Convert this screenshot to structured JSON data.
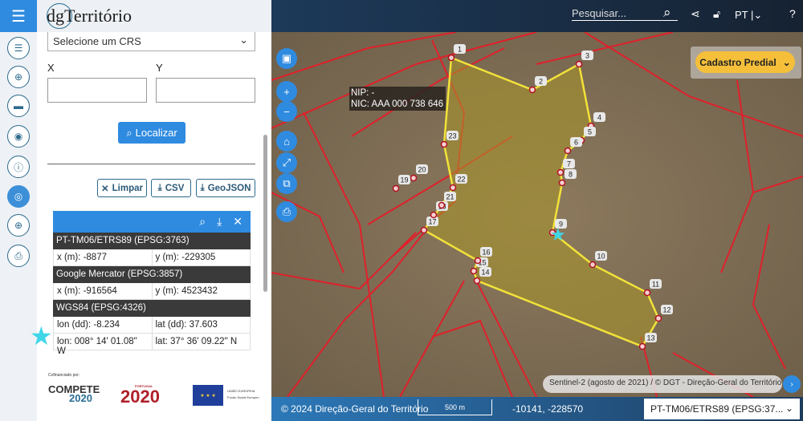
{
  "header": {
    "logo": "dgTerritório",
    "search_placeholder": "Pesquisar...",
    "language": "PT"
  },
  "rail": {
    "icons": [
      "menu-icon",
      "list-icon",
      "add-circle-icon",
      "ruler-icon",
      "palette-icon",
      "info-icon",
      "target-icon",
      "globe-icon",
      "print-icon"
    ],
    "active": "target-icon"
  },
  "panel": {
    "crs_select": "Selecione um CRS",
    "x_label": "X",
    "y_label": "Y",
    "x_value": "",
    "y_value": "",
    "localizar": "Localizar",
    "limpar": "Limpar",
    "csv": "CSV",
    "geojson": "GeoJSON",
    "results": [
      {
        "crs": "PT-TM06/ETRS89 (EPSG:3763)",
        "a": "x (m): -8877",
        "b": "y (m): -229305"
      },
      {
        "crs": "Google Mercator (EPSG:3857)",
        "a": "x (m): -916564",
        "b": "y (m): 4523432"
      },
      {
        "crs": "WGS84 (EPSG:4326)",
        "a": "lon (dd): -8.234",
        "b": "lat (dd): 37.603",
        "c": "lon: 008° 14' 01.08\" W",
        "d": "lat: 37° 36' 09.22\" N"
      }
    ],
    "cofinanciado": "Cofinanciado por:",
    "logos": {
      "compete": "COMPETE",
      "compete_year": "2020",
      "portugal": "PORTUGAL",
      "portugal_year": "2020",
      "eu1": "UNIÃO EUROPEIA",
      "eu2": "Fundo Social Europeu"
    }
  },
  "map": {
    "tooltip": {
      "nip": "NIP: -",
      "nic": "NIC: AAA 000 738 646"
    },
    "layer_button": "Cadastro Predial",
    "vertex_labels": [
      "1",
      "2",
      "3",
      "4",
      "5",
      "6",
      "7",
      "8",
      "9",
      "10",
      "11",
      "12",
      "13",
      "14",
      "15",
      "16",
      "17",
      "18",
      "19",
      "20",
      "21",
      "22",
      "23"
    ],
    "attribution": "Sentinel-2 (agosto de 2021) / © DGT - Direção-Geral do Território",
    "colors": {
      "parcel_lines": "#e0202a",
      "selected_outline": "#f2e23a",
      "selected_fill": "#b89a2a",
      "marker": "#3fd6e8"
    }
  },
  "footer": {
    "copyright": "© 2024 Direção-Geral do Território",
    "scale": "500 m",
    "mouse_position": "-10141, -228570",
    "crs": "PT-TM06/ETRS89 (EPSG:37..."
  }
}
